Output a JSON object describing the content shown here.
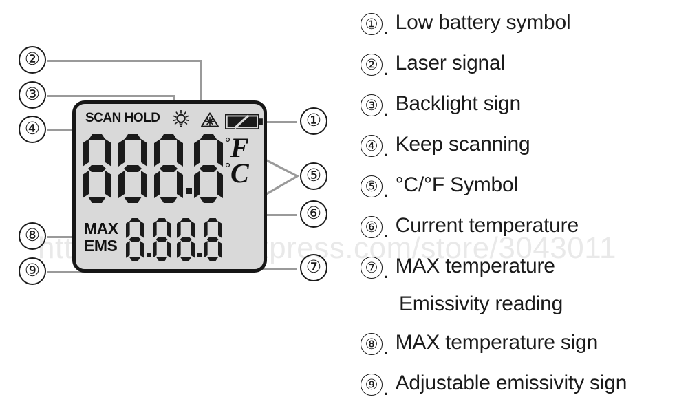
{
  "watermark": {
    "text": "https://www.aliexpress.com/store/3043011"
  },
  "device": {
    "type": "infrared-thermometer-lcd",
    "status_bar": {
      "scan_hold_label": "SCAN HOLD",
      "backlight_icon": "lightbulb-icon",
      "laser_icon": "laser-warning-triangle-icon",
      "battery_icon": "low-battery-icon"
    },
    "main_display": {
      "value": "888.8",
      "digits": [
        "8",
        "8",
        "8",
        "8"
      ],
      "decimal_after_index": 2,
      "unit_f": "F",
      "unit_c": "C",
      "degree": "°"
    },
    "sub_display": {
      "max_label": "MAX",
      "ems_label": "EMS",
      "value": "8.88.8",
      "digits": [
        "8",
        "8",
        "8",
        "8"
      ],
      "decimal_after_indices": [
        0,
        2
      ]
    }
  },
  "callouts": [
    {
      "id": "1",
      "symbol": "①",
      "side": "right"
    },
    {
      "id": "2",
      "symbol": "②",
      "side": "left"
    },
    {
      "id": "3",
      "symbol": "③",
      "side": "left"
    },
    {
      "id": "4",
      "symbol": "④",
      "side": "left"
    },
    {
      "id": "5",
      "symbol": "⑤",
      "side": "right"
    },
    {
      "id": "6",
      "symbol": "⑥",
      "side": "right"
    },
    {
      "id": "7",
      "symbol": "⑦",
      "side": "right"
    },
    {
      "id": "8",
      "symbol": "⑧",
      "side": "left"
    },
    {
      "id": "9",
      "symbol": "⑨",
      "side": "left"
    }
  ],
  "legend": {
    "items": [
      {
        "num": "①",
        "sep": ".",
        "text": "Low  battery symbol"
      },
      {
        "num": "②",
        "sep": ".",
        "text": "Laser signal"
      },
      {
        "num": "③",
        "sep": ".",
        "text": "Backlight sign"
      },
      {
        "num": "④",
        "sep": ".",
        "text": "Keep scanning"
      },
      {
        "num": "⑤",
        "sep": ".",
        "text": "°C/°F Symbol"
      },
      {
        "num": "⑥",
        "sep": ".",
        "text": "Current temperature"
      },
      {
        "num": "⑦",
        "sep": ".",
        "text": "MAX temperature"
      },
      {
        "num": "",
        "sep": "",
        "text": "Emissivity reading"
      },
      {
        "num": "⑧",
        "sep": ".",
        "text": "MAX temperature sign"
      },
      {
        "num": "⑨",
        "sep": ".",
        "text": "Adjustable emissivity sign"
      }
    ]
  },
  "colors": {
    "lcd_background": "#d9d9d9",
    "lcd_border": "#161616",
    "segment": "#1b1b1b",
    "leader_line": "#9a9a9a",
    "watermark": "#e9e9e9",
    "page_background": "#ffffff"
  }
}
